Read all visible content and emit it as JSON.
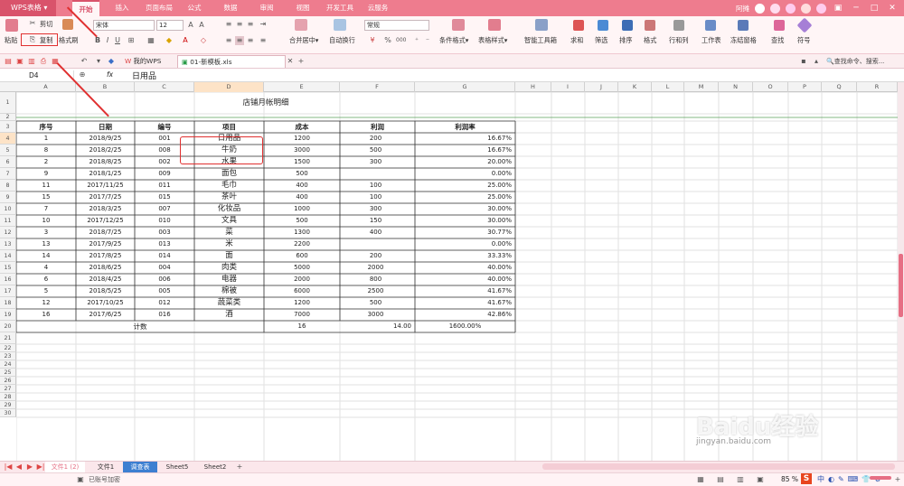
{
  "app": {
    "title": "WPS表格"
  },
  "menu_tabs": [
    "开始",
    "插入",
    "页面布局",
    "公式",
    "数据",
    "审阅",
    "视图",
    "开发工具",
    "云服务"
  ],
  "titlebar_right": {
    "user": "阿摊"
  },
  "ribbon": {
    "paste": "粘贴",
    "cut": "剪切",
    "copy": "复制",
    "format_painter": "格式刷",
    "font_name": "宋体",
    "font_size": "12",
    "bold": "B",
    "italic": "I",
    "underline": "U",
    "number_format": "常规",
    "merge": "合并居中",
    "wrap": "自动换行",
    "percent": "%",
    "thousands": "000",
    "cond_format": "条件格式",
    "table_style": "表格样式",
    "smart_toolbox": "智能工具箱",
    "sum": "求和",
    "filter": "筛选",
    "sort": "排序",
    "format": "格式",
    "rowcol": "行和列",
    "worksheet": "工作表",
    "freeze": "冻结窗格",
    "find": "查找",
    "symbol": "符号"
  },
  "docbar": {
    "home_tab": "我的WPS",
    "file_tab": "01-新模板.xls",
    "search": "查找命令、搜索..."
  },
  "formula_bar": {
    "cell_ref": "D4",
    "fx": "fx",
    "value": "日用品"
  },
  "columns": [
    "A",
    "B",
    "C",
    "D",
    "E",
    "F",
    "G",
    "H",
    "I",
    "J",
    "K",
    "L",
    "M",
    "N",
    "O",
    "P",
    "Q",
    "R"
  ],
  "rows": [
    "1",
    "2",
    "3",
    "4",
    "5",
    "6",
    "7",
    "8",
    "9",
    "10",
    "11",
    "12",
    "13",
    "14",
    "15",
    "16",
    "17",
    "18",
    "19",
    "20",
    "21",
    "22",
    "23",
    "24",
    "25",
    "26",
    "27",
    "28",
    "29",
    "30"
  ],
  "sheet": {
    "title": "店铺月帐明细",
    "headers": [
      "序号",
      "日期",
      "编号",
      "项目",
      "成本",
      "利润",
      "利润率"
    ],
    "data": [
      [
        "1",
        "2018/9/25",
        "001",
        "日用品",
        "1200",
        "200",
        "16.67%"
      ],
      [
        "8",
        "2018/2/25",
        "008",
        "牛奶",
        "3000",
        "500",
        "16.67%"
      ],
      [
        "2",
        "2018/8/25",
        "002",
        "水果",
        "1500",
        "300",
        "20.00%"
      ],
      [
        "9",
        "2018/1/25",
        "009",
        "面包",
        "500",
        "",
        "0.00%"
      ],
      [
        "11",
        "2017/11/25",
        "011",
        "毛巾",
        "400",
        "100",
        "25.00%"
      ],
      [
        "15",
        "2017/7/25",
        "015",
        "茶叶",
        "400",
        "100",
        "25.00%"
      ],
      [
        "7",
        "2018/3/25",
        "007",
        "化妆品",
        "1000",
        "300",
        "30.00%"
      ],
      [
        "10",
        "2017/12/25",
        "010",
        "文具",
        "500",
        "150",
        "30.00%"
      ],
      [
        "3",
        "2018/7/25",
        "003",
        "菜",
        "1300",
        "400",
        "30.77%"
      ],
      [
        "13",
        "2017/9/25",
        "013",
        "米",
        "2200",
        "",
        "0.00%"
      ],
      [
        "14",
        "2017/8/25",
        "014",
        "面",
        "600",
        "200",
        "33.33%"
      ],
      [
        "4",
        "2018/6/25",
        "004",
        "肉类",
        "5000",
        "2000",
        "40.00%"
      ],
      [
        "6",
        "2018/4/25",
        "006",
        "电器",
        "2000",
        "800",
        "40.00%"
      ],
      [
        "5",
        "2018/5/25",
        "005",
        "棉被",
        "6000",
        "2500",
        "41.67%"
      ],
      [
        "12",
        "2017/10/25",
        "012",
        "蔬菜类",
        "1200",
        "500",
        "41.67%"
      ],
      [
        "16",
        "2017/6/25",
        "016",
        "酒",
        "7000",
        "3000",
        "42.86%"
      ]
    ],
    "total_label": "计数",
    "total_count": "16",
    "total_profit": "14.00",
    "total_rate": "1600.00%"
  },
  "sheet_tabs": [
    "文件1 (2)",
    "文件1",
    "调查表",
    "Sheet5",
    "Sheet2"
  ],
  "status": {
    "left": "已账号加密",
    "zoom": "85 %"
  },
  "watermark": {
    "logo": "Baidu经验",
    "url": "jingyan.baidu.com"
  }
}
